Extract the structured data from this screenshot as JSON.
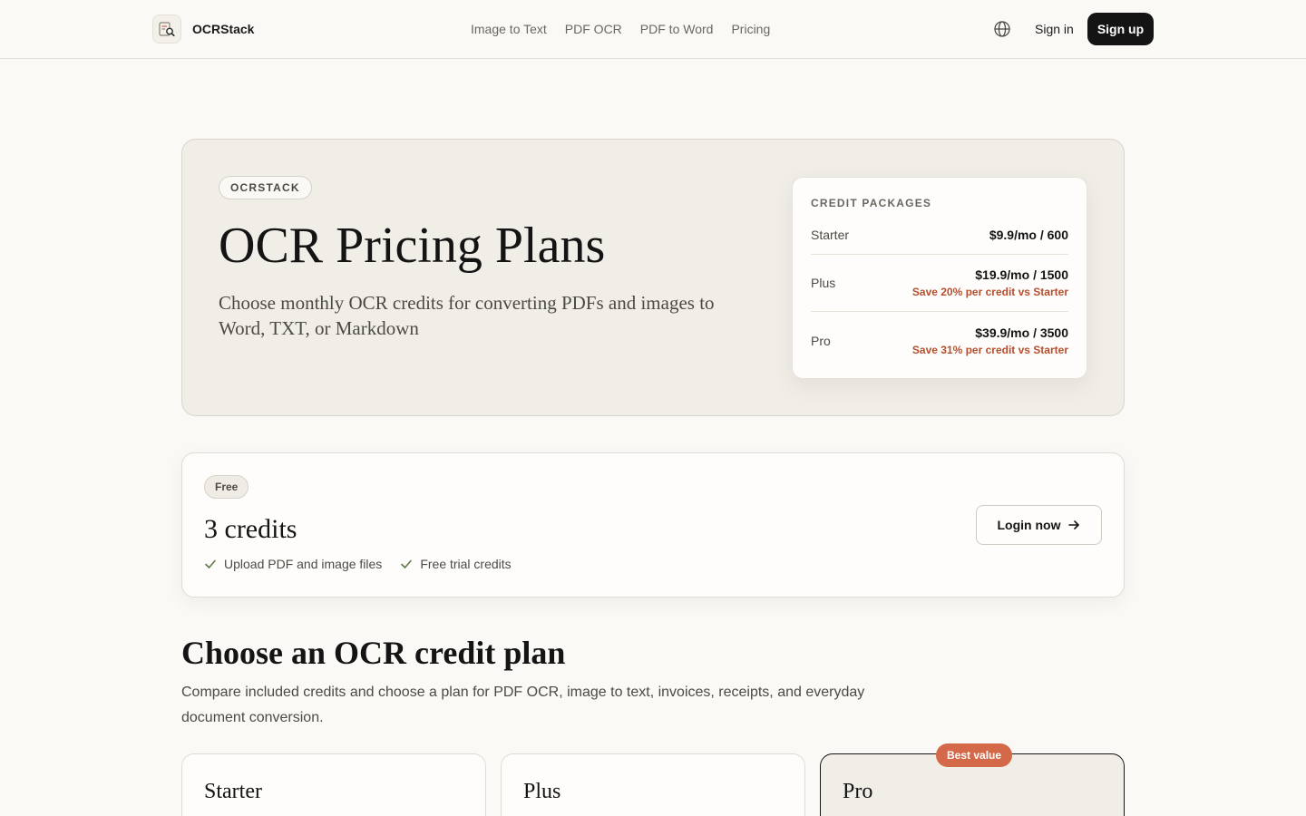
{
  "header": {
    "brand": "OCRStack",
    "nav": [
      "Image to Text",
      "PDF OCR",
      "PDF to Word",
      "Pricing"
    ],
    "signin": "Sign in",
    "signup": "Sign up",
    "icons": {
      "logo": "document-search-icon",
      "language": "globe-icon"
    }
  },
  "hero": {
    "tag": "OCRSTACK",
    "title": "OCR Pricing Plans",
    "subtitle": "Choose monthly OCR credits for converting PDFs and images to Word, TXT, or Markdown"
  },
  "packages": {
    "heading": "CREDIT PACKAGES",
    "items": [
      {
        "name": "Starter",
        "price": "$9.9/mo / 600",
        "save": ""
      },
      {
        "name": "Plus",
        "price": "$19.9/mo / 1500",
        "save": "Save 20% per credit vs Starter"
      },
      {
        "name": "Pro",
        "price": "$39.9/mo / 3500",
        "save": "Save 31% per credit vs Starter"
      }
    ]
  },
  "free": {
    "badge": "Free",
    "title": "3 credits",
    "features": [
      "Upload PDF and image files",
      "Free trial credits"
    ],
    "button": "Login now"
  },
  "section": {
    "title": "Choose an OCR credit plan",
    "subtitle": "Compare included credits and choose a plan for PDF OCR, image to text, invoices, receipts, and everyday document conversion."
  },
  "plans": [
    {
      "name": "Starter"
    },
    {
      "name": "Plus"
    },
    {
      "name": "Pro",
      "badge": "Best value"
    }
  ],
  "colors": {
    "background": "#faf9f6",
    "accent": "#d4694a",
    "savings": "#b4502f",
    "dark": "#141414"
  }
}
